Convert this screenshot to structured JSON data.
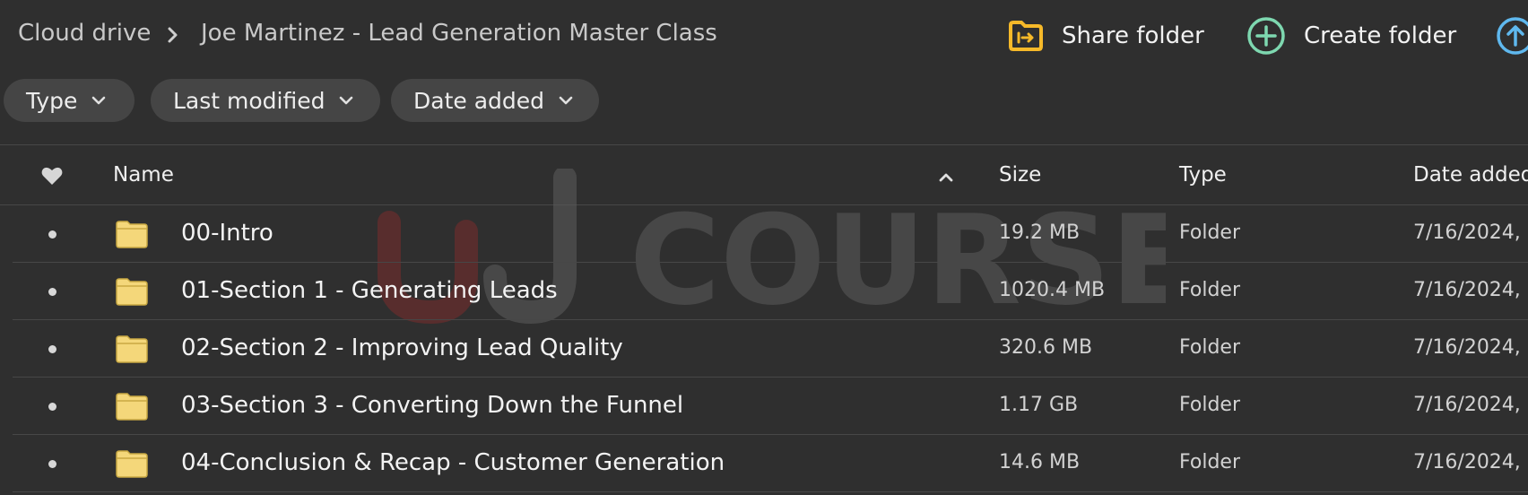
{
  "breadcrumb": {
    "root": "Cloud drive",
    "current": "Joe Martinez - Lead Generation Master Class"
  },
  "actions": {
    "share_folder": "Share folder",
    "create_folder": "Create folder"
  },
  "filters": {
    "type": "Type",
    "last_modified": "Last modified",
    "date_added": "Date added"
  },
  "table": {
    "columns": {
      "name": "Name",
      "size": "Size",
      "type": "Type",
      "date_added": "Date added"
    },
    "sort": {
      "column": "Name",
      "direction": "ascending"
    },
    "rows": [
      {
        "name": "00-Intro",
        "size": "19.2 MB",
        "type": "Folder",
        "date_added": "7/16/2024,"
      },
      {
        "name": "01-Section 1 - Generating Leads",
        "size": "1020.4 MB",
        "type": "Folder",
        "date_added": "7/16/2024,"
      },
      {
        "name": "02-Section 2 - Improving Lead Quality",
        "size": "320.6 MB",
        "type": "Folder",
        "date_added": "7/16/2024,"
      },
      {
        "name": "03-Section 3 - Converting Down the Funnel",
        "size": "1.17 GB",
        "type": "Folder",
        "date_added": "7/16/2024,"
      },
      {
        "name": "04-Conclusion & Recap - Customer Generation",
        "size": "14.6 MB",
        "type": "Folder",
        "date_added": "7/16/2024,"
      }
    ]
  },
  "watermark": {
    "text": "COURSE"
  },
  "icons": {
    "share": "folder-share-icon",
    "create": "plus-circle-icon",
    "upload": "upload-icon",
    "favourite": "heart-icon",
    "folder": "folder-icon",
    "sort": "chevron-up-icon"
  },
  "colors": {
    "background": "#2f2f2f",
    "chip": "#454545",
    "share_icon": "#f6b929",
    "create_icon": "#7ed8b0",
    "upload_icon": "#5fb8ee",
    "folder": "#f4d77a",
    "watermark_red": "#7a2c2c"
  }
}
